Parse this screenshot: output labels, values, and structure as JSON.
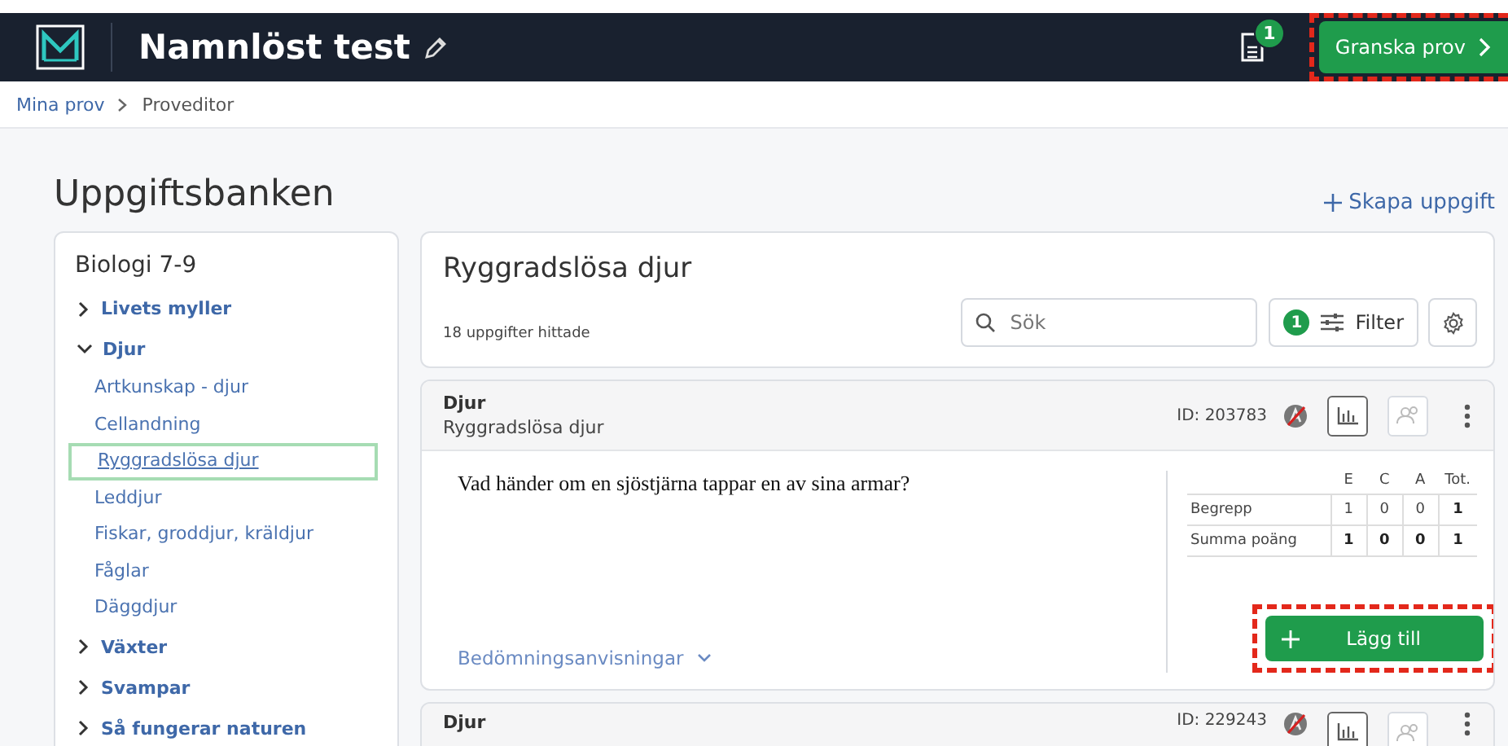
{
  "header": {
    "title": "Namnlöst test",
    "doc_badge": "1",
    "review_button": {
      "label": "Granska prov",
      "highlighted": true
    }
  },
  "breadcrumb": [
    "Mina prov",
    "Proveditor"
  ],
  "page_title": "Uppgiftsbanken",
  "create_link": "Skapa uppgift",
  "sidebar": {
    "title": "Biologi 7-9",
    "items": [
      {
        "label": "Livets myller",
        "expanded": false
      },
      {
        "label": "Djur",
        "expanded": true,
        "children": [
          {
            "label": "Artkunskap - djur",
            "selected": false
          },
          {
            "label": "Cellandning",
            "selected": false
          },
          {
            "label": "Ryggradslösa djur",
            "selected": true
          },
          {
            "label": "Leddjur",
            "selected": false
          },
          {
            "label": "Fiskar, groddjur, kräldjur",
            "selected": false
          },
          {
            "label": "Fåglar",
            "selected": false
          },
          {
            "label": "Däggdjur",
            "selected": false
          }
        ]
      },
      {
        "label": "Växter",
        "expanded": false
      },
      {
        "label": "Svampar",
        "expanded": false
      },
      {
        "label": "Så fungerar naturen",
        "expanded": false
      }
    ]
  },
  "results": {
    "title": "Ryggradslösa djur",
    "count": "18 uppgifter hittade",
    "search": {
      "placeholder": "Sök"
    },
    "filter": {
      "label": "Filter",
      "badge": "1"
    }
  },
  "tasks": [
    {
      "category": "Djur",
      "topic": "Ryggradslösa djur",
      "id": "ID: 203783",
      "question": "Vad händer om en sjöstjärna tappar en av sina armar?",
      "points": {
        "columns": [
          "E",
          "C",
          "A",
          "Tot."
        ],
        "rows": [
          {
            "kind": "criterion",
            "label": "Begrepp",
            "values": [
              "1",
              "0",
              "0",
              "1"
            ]
          },
          {
            "kind": "sum",
            "label": "Summa poäng",
            "values": [
              "1",
              "0",
              "0",
              "1"
            ]
          }
        ]
      },
      "guide_link": "Bedömningsanvisningar",
      "add_button": {
        "label": "Lägg till",
        "highlighted": true
      }
    },
    {
      "category": "Djur",
      "id": "ID: 229243"
    }
  ]
}
